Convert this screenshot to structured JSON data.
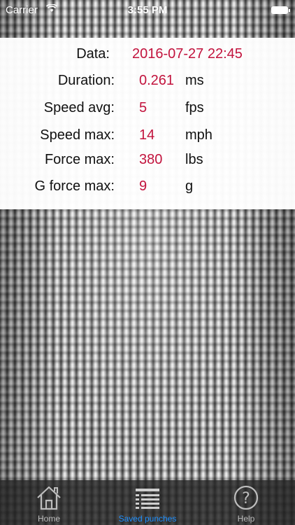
{
  "status_bar": {
    "carrier": "Carrier",
    "time": "3:55 PM"
  },
  "details": {
    "date_label": "Data:",
    "date_value": "2016-07-27 22:45",
    "rows": [
      {
        "label": "Duration:",
        "value": "0.261",
        "unit": "ms"
      },
      {
        "label": "Speed avg:",
        "value": "5",
        "unit": "fps"
      },
      {
        "label": "Speed max:",
        "value": "14",
        "unit": "mph"
      },
      {
        "label": "Force max:",
        "value": "380",
        "unit": "lbs"
      },
      {
        "label": "G force max:",
        "value": "9",
        "unit": "g"
      }
    ]
  },
  "tabs": [
    {
      "label": "Home",
      "icon": "home-icon"
    },
    {
      "label": "Saved punches",
      "icon": "list-icon",
      "active": true
    },
    {
      "label": "Help",
      "icon": "help-icon"
    }
  ],
  "colors": {
    "value": "#c2133d",
    "active_tab": "#1e90ff"
  }
}
